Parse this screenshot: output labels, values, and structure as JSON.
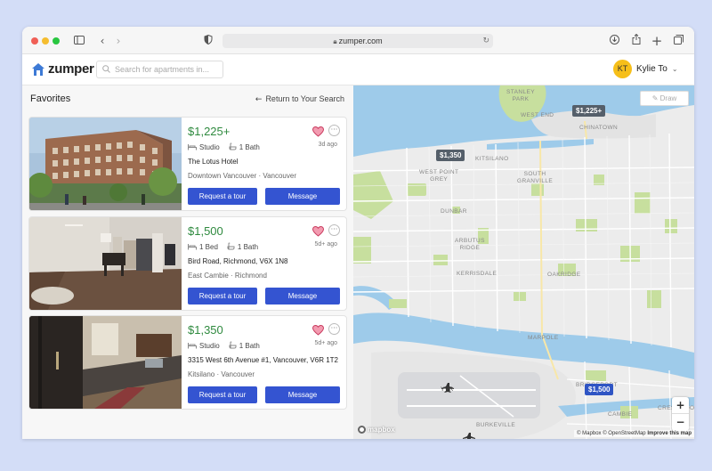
{
  "browser": {
    "url": "zumper.com"
  },
  "header": {
    "logo_text": "zumper",
    "search_placeholder": "Search for apartments in...",
    "user_initials": "KT",
    "user_name": "Kylie To"
  },
  "panel": {
    "title": "Favorites",
    "return_label": "Return to Your Search",
    "listings": [
      {
        "price": "$1,225+",
        "beds": "Studio",
        "baths": "1 Bath",
        "name": "The Lotus Hotel",
        "neighborhood": "Downtown Vancouver · Vancouver",
        "ago": "3d ago",
        "tour_label": "Request a tour",
        "message_label": "Message"
      },
      {
        "price": "$1,500",
        "beds": "1 Bed",
        "baths": "1 Bath",
        "name": "Bird Road, Richmond, V6X 1N8",
        "neighborhood": "East Cambie · Richmond",
        "ago": "5d+ ago",
        "tour_label": "Request a tour",
        "message_label": "Message"
      },
      {
        "price": "$1,350",
        "beds": "Studio",
        "baths": "1 Bath",
        "name": "3315 West 6th Avenue #1, Vancouver, V6R 1T2",
        "neighborhood": "Kitsilano · Vancouver",
        "ago": "5d+ ago",
        "tour_label": "Request a tour",
        "message_label": "Message"
      }
    ]
  },
  "map": {
    "draw_label": "Draw",
    "pins": [
      "$1,225+",
      "$1,350",
      "$1,500"
    ],
    "labels": {
      "stanley_park": "STANLEY\nPARK",
      "west_end": "WEST END",
      "chinatown": "CHINATOWN",
      "kitsilano": "KITSILANO",
      "west_point_grey": "WEST POINT\nGREY",
      "south_granville": "SOUTH\nGRANVILLE",
      "dunbar": "DUNBAR",
      "arbutus_ridge": "ARBUTUS\nRIDGE",
      "kerrisdale": "KERRISDALE",
      "oakridge": "OAKRIDGE",
      "marpole": "MARPOLE",
      "yvr": "YVR",
      "burkeville": "BURKEVILLE",
      "bridgeport": "BRIDGEPORT",
      "cambie": "CAMBIE",
      "crestwood": "CRESTWOOD"
    },
    "mapbox_label": "mapbox",
    "attribution": "© Mapbox © OpenStreetMap",
    "improve_label": "Improve this map",
    "zoom_in": "+",
    "zoom_out": "−"
  },
  "colors": {
    "accent": "#3454d1",
    "price": "#2f8a3f",
    "water": "#9ecbea",
    "land": "#ececec",
    "park": "#c7df9e",
    "avatar": "#f6bf1a"
  }
}
